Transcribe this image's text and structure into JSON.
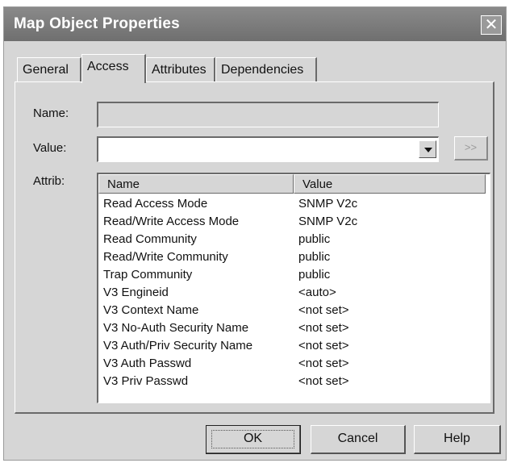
{
  "window": {
    "title": "Map Object Properties",
    "close_glyph": "✕"
  },
  "tabs": [
    {
      "label": "General"
    },
    {
      "label": "Access"
    },
    {
      "label": "Attributes"
    },
    {
      "label": "Dependencies"
    }
  ],
  "active_tab": "Access",
  "form": {
    "name_label": "Name:",
    "name_value": "",
    "value_label": "Value:",
    "value_value": "",
    "more_label": ">>",
    "attrib_label": "Attrib:"
  },
  "attributes": {
    "columns": [
      "Name",
      "Value"
    ],
    "rows": [
      {
        "name": "Read Access Mode",
        "value": "SNMP V2c"
      },
      {
        "name": "Read/Write Access Mode",
        "value": "SNMP V2c"
      },
      {
        "name": "Read Community",
        "value": "public"
      },
      {
        "name": "Read/Write Community",
        "value": "public"
      },
      {
        "name": "Trap Community",
        "value": "public"
      },
      {
        "name": "V3 Engineid",
        "value": "<auto>"
      },
      {
        "name": "V3 Context Name",
        "value": "<not set>"
      },
      {
        "name": "V3 No-Auth Security Name",
        "value": "<not set>"
      },
      {
        "name": "V3 Auth/Priv Security Name",
        "value": "<not set>"
      },
      {
        "name": "V3 Auth Passwd",
        "value": "<not set>"
      },
      {
        "name": "V3 Priv Passwd",
        "value": "<not set>"
      }
    ]
  },
  "buttons": {
    "ok": "OK",
    "cancel": "Cancel",
    "help": "Help"
  }
}
